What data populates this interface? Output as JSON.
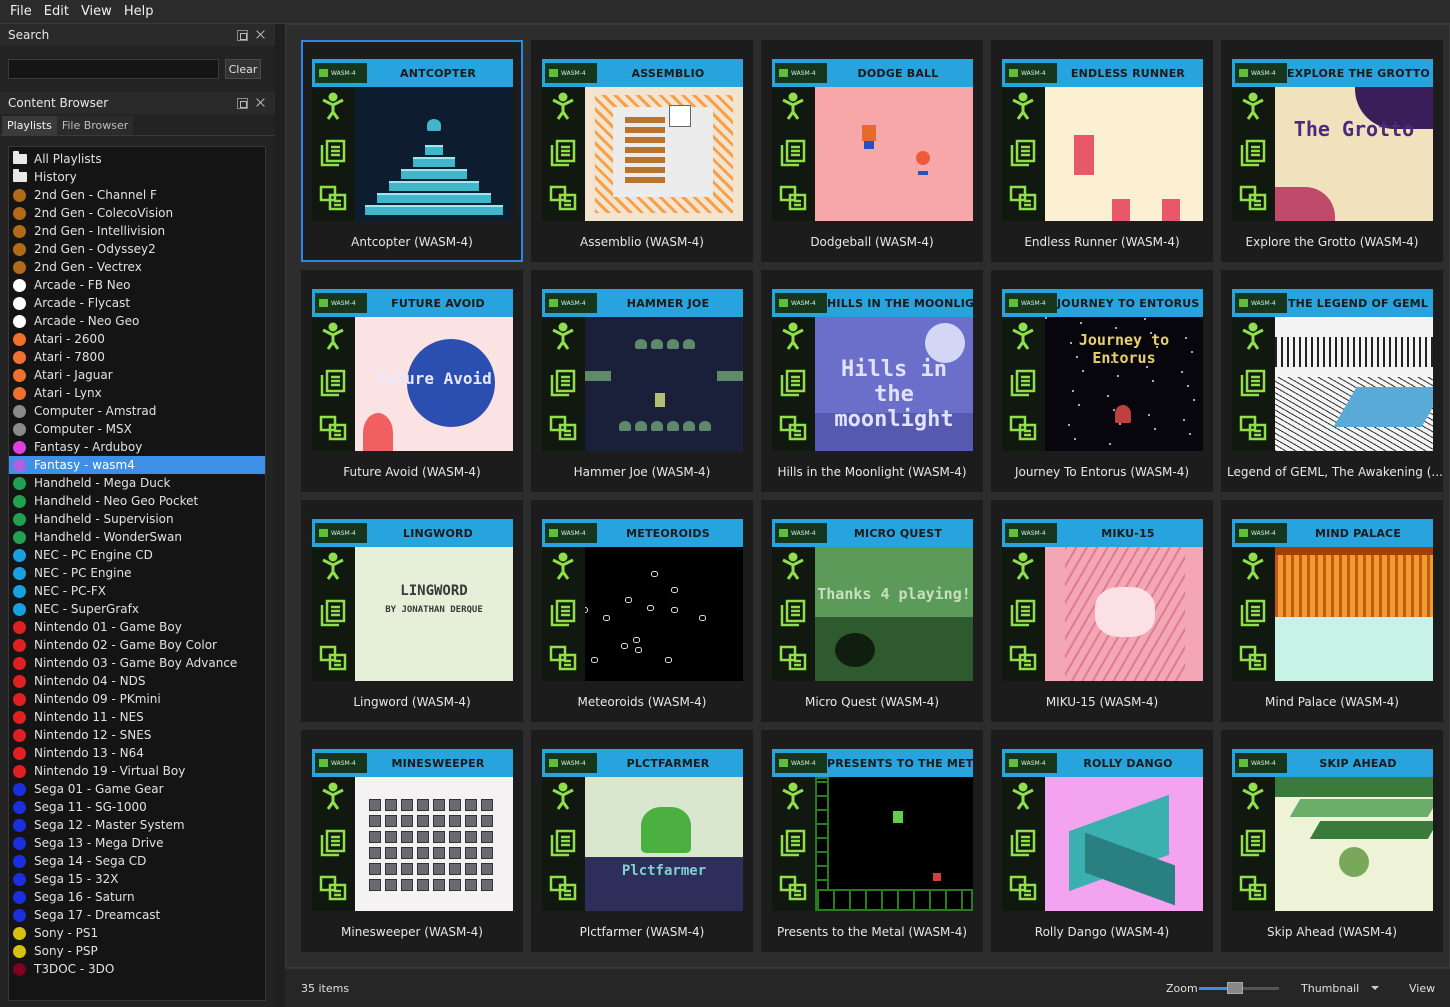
{
  "menubar": {
    "items": [
      "File",
      "Edit",
      "View",
      "Help"
    ]
  },
  "search": {
    "title": "Search",
    "value": "",
    "clear_label": "Clear"
  },
  "content_browser": {
    "title": "Content Browser",
    "tabs": [
      "Playlists",
      "File Browser"
    ],
    "playlists": [
      {
        "label": "All Playlists",
        "icon": "folder-icon"
      },
      {
        "label": "History",
        "icon": "folder-icon"
      },
      {
        "label": "2nd Gen - Channel F",
        "color": "#b06a1a"
      },
      {
        "label": "2nd Gen - ColecoVision",
        "color": "#b06a1a"
      },
      {
        "label": "2nd Gen - Intellivision",
        "color": "#b06a1a"
      },
      {
        "label": "2nd Gen - Odyssey2",
        "color": "#b06a1a"
      },
      {
        "label": "2nd Gen - Vectrex",
        "color": "#b06a1a"
      },
      {
        "label": "Arcade - FB Neo",
        "color": "#ffffff"
      },
      {
        "label": "Arcade - Flycast",
        "color": "#ffffff"
      },
      {
        "label": "Arcade - Neo Geo",
        "color": "#ffffff"
      },
      {
        "label": "Atari - 2600",
        "color": "#f07030"
      },
      {
        "label": "Atari - 7800",
        "color": "#f07030"
      },
      {
        "label": "Atari - Jaguar",
        "color": "#f07030"
      },
      {
        "label": "Atari - Lynx",
        "color": "#f07030"
      },
      {
        "label": "Computer - Amstrad",
        "color": "#8a8a8a"
      },
      {
        "label": "Computer - MSX",
        "color": "#8a8a8a"
      },
      {
        "label": "Fantasy - Arduboy",
        "color": "#e040e0"
      },
      {
        "label": "Fantasy - wasm4",
        "color": "#b060e0",
        "selected": true
      },
      {
        "label": "Handheld - Mega Duck",
        "color": "#20a050"
      },
      {
        "label": "Handheld - Neo Geo Pocket",
        "color": "#20a050"
      },
      {
        "label": "Handheld - Supervision",
        "color": "#20a050"
      },
      {
        "label": "Handheld - WonderSwan",
        "color": "#20a050"
      },
      {
        "label": "NEC - PC Engine CD",
        "color": "#1aa0e0"
      },
      {
        "label": "NEC - PC Engine",
        "color": "#1aa0e0"
      },
      {
        "label": "NEC - PC-FX",
        "color": "#1aa0e0"
      },
      {
        "label": "NEC - SuperGrafx",
        "color": "#1aa0e0"
      },
      {
        "label": "Nintendo 01 - Game Boy",
        "color": "#e02020"
      },
      {
        "label": "Nintendo 02 - Game Boy Color",
        "color": "#e02020"
      },
      {
        "label": "Nintendo 03 - Game Boy Advance",
        "color": "#e02020"
      },
      {
        "label": "Nintendo 04 - NDS",
        "color": "#e02020"
      },
      {
        "label": "Nintendo 09 - PKmini",
        "color": "#e02020"
      },
      {
        "label": "Nintendo 11 - NES",
        "color": "#e02020"
      },
      {
        "label": "Nintendo 12 - SNES",
        "color": "#e02020"
      },
      {
        "label": "Nintendo 13 - N64",
        "color": "#e02020"
      },
      {
        "label": "Nintendo 19 - Virtual Boy",
        "color": "#e02020"
      },
      {
        "label": "Sega 01 - Game Gear",
        "color": "#1a30e0"
      },
      {
        "label": "Sega 11 - SG-1000",
        "color": "#1a30e0"
      },
      {
        "label": "Sega 12 - Master System",
        "color": "#1a30e0"
      },
      {
        "label": "Sega 13 - Mega Drive",
        "color": "#1a30e0"
      },
      {
        "label": "Sega 14 - Sega CD",
        "color": "#1a30e0"
      },
      {
        "label": "Sega 15 - 32X",
        "color": "#1a30e0"
      },
      {
        "label": "Sega 16 - Saturn",
        "color": "#1a30e0"
      },
      {
        "label": "Sega 17 - Dreamcast",
        "color": "#1a30e0"
      },
      {
        "label": "Sony - PS1",
        "color": "#d8c010"
      },
      {
        "label": "Sony - PSP",
        "color": "#d8c010"
      },
      {
        "label": "T3DOC - 3DO",
        "color": "#800020"
      }
    ]
  },
  "grid": {
    "chip_label": "WASM-4",
    "games": [
      {
        "label": "Antcopter (WASM-4)",
        "banner": "ANTCOPTER",
        "bg": "#0d1c2e",
        "selected": true,
        "art": "pyramid"
      },
      {
        "label": "Assemblio (WASM-4)",
        "banner": "ASSEMBLIO",
        "bg": "#f3e4d0",
        "art": "assemblio"
      },
      {
        "label": "Dodgeball (WASM-4)",
        "banner": "DODGE BALL",
        "bg": "#f7a7a7",
        "art": "dodgeball"
      },
      {
        "label": "Endless Runner (WASM-4)",
        "banner": "ENDLESS RUNNER",
        "bg": "#fbf1d2",
        "art": "runner"
      },
      {
        "label": "Explore the Grotto (WASM-4)",
        "banner": "EXPLORE THE GROTTO",
        "bg": "#efe2bc",
        "art": "grotto",
        "screen_text": "The Grotto"
      },
      {
        "label": "Future Avoid (WASM-4)",
        "banner": "FUTURE AVOID",
        "bg": "#fbe3e3",
        "art": "future",
        "screen_text": "Future Avoid"
      },
      {
        "label": "Hammer Joe (WASM-4)",
        "banner": "HAMMER JOE",
        "bg": "#1a1f3a",
        "art": "hammer"
      },
      {
        "label": "Hills in the Moonlight (WASM-4)",
        "banner": "HILLS IN THE MOONLIGHT",
        "bg": "#6c6fc9",
        "art": "hills",
        "screen_text": "Hills in the moonlight"
      },
      {
        "label": "Journey To Entorus (WASM-4)",
        "banner": "JOURNEY TO ENTORUS",
        "bg": "#06060c",
        "art": "journey",
        "screen_text": "Journey to Entorus"
      },
      {
        "label": "Legend of GEML, The Awakening (...",
        "banner": "THE LEGEND OF GEML",
        "bg": "#f4f4f4",
        "art": "geml"
      },
      {
        "label": "Lingword (WASM-4)",
        "banner": "LINGWORD",
        "bg": "#e6efd8",
        "art": "lingword",
        "screen_text": "LINGWORD",
        "screen_sub": "BY JONATHAN DERQUE"
      },
      {
        "label": "Meteoroids (WASM-4)",
        "banner": "METEOROIDS",
        "bg": "#000000",
        "art": "meteoroids"
      },
      {
        "label": "Micro Quest (WASM-4)",
        "banner": "MICRO QUEST",
        "bg": "#5c9a5a",
        "art": "microquest",
        "screen_text": "Thanks 4 playing!"
      },
      {
        "label": "MIKU-15 (WASM-4)",
        "banner": "MIKU-15",
        "bg": "#f3a6b4",
        "art": "miku"
      },
      {
        "label": "Mind Palace (WASM-4)",
        "banner": "MIND PALACE",
        "bg": "#c7f2e6",
        "art": "palace"
      },
      {
        "label": "Minesweeper (WASM-4)",
        "banner": "MINESWEEPER",
        "bg": "#f4f2f2",
        "art": "mines"
      },
      {
        "label": "Plctfarmer (WASM-4)",
        "banner": "PLCTFARMER",
        "bg": "#d9e7cf",
        "art": "farmer",
        "screen_text": "Plctfarmer"
      },
      {
        "label": "Presents to the Metal (WASM-4)",
        "banner": "PRESENTS TO THE METAL",
        "bg": "#000000",
        "art": "presents"
      },
      {
        "label": "Rolly Dango (WASM-4)",
        "banner": "ROLLY DANGO",
        "bg": "#f4a3f0",
        "art": "rolly"
      },
      {
        "label": "Skip Ahead (WASM-4)",
        "banner": "SKIP AHEAD",
        "bg": "#eef3d8",
        "art": "skip"
      }
    ]
  },
  "status": {
    "item_count": "35 items",
    "zoom_label": "Zoom",
    "zoom_value": 0.45,
    "view_mode": "Thumbnail",
    "view_label": "View"
  },
  "colors": {
    "accent": "#3d8fe8",
    "banner": "#27a3dd",
    "wasm_green": "#8fe04a"
  }
}
